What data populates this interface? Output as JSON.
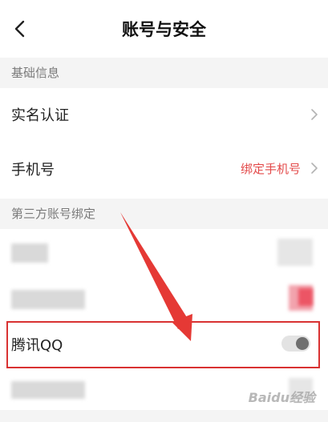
{
  "header": {
    "title": "账号与安全",
    "back_icon": "chevron-left-icon"
  },
  "sections": {
    "basic_info": {
      "label": "基础信息",
      "rows": {
        "real_name": {
          "label": "实名认证",
          "icon": "chevron-right-icon"
        },
        "phone": {
          "label": "手机号",
          "value": "绑定手机号",
          "icon": "chevron-right-icon"
        }
      }
    },
    "third_party": {
      "label": "第三方账号绑定",
      "rows": {
        "qq": {
          "label": "腾讯QQ",
          "toggle_on": false
        }
      }
    }
  },
  "annotation": {
    "highlight_color": "#d93232",
    "arrow_color": "#e53935"
  },
  "watermark": {
    "text": "Baidu经验"
  },
  "colors": {
    "accent_text": "#e34a4a",
    "section_bg": "#f4f4f4"
  }
}
